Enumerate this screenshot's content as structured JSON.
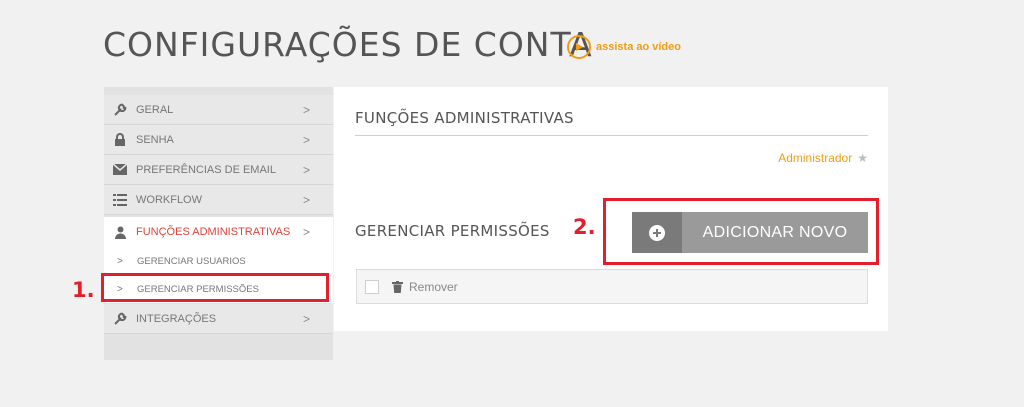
{
  "page": {
    "title": "CONFIGURAÇÕES DE CONTA",
    "watch_video": "assista ao vídeo"
  },
  "sidebar": {
    "items": [
      {
        "label": "GERAL",
        "icon": "wrench-icon"
      },
      {
        "label": "SENHA",
        "icon": "lock-icon"
      },
      {
        "label": "PREFERÊNCIAS DE EMAIL",
        "icon": "envelope-icon"
      },
      {
        "label": "WORKFLOW",
        "icon": "list-icon"
      },
      {
        "label": "FUNÇÕES ADMINISTRATIVAS",
        "icon": "user-icon"
      },
      {
        "label": "INTEGRAÇÕES",
        "icon": "wrench-icon"
      }
    ],
    "subitems": [
      {
        "label": "GERENCIAR USUARIOS"
      },
      {
        "label": "GERENCIAR PERMISSÕES"
      }
    ]
  },
  "annotations": {
    "one": "1.",
    "two": "2."
  },
  "panel": {
    "title": "FUNÇÕES ADMINISTRATIVAS",
    "admin_link": "Administrador",
    "section_title": "GERENCIAR PERMISSÕES",
    "add_button": "ADICIONAR NOVO",
    "remove_label": "Remover"
  },
  "colors": {
    "accent_orange": "#f39c12",
    "active_red": "#e0433a",
    "annotation_red": "#e41f2b"
  }
}
